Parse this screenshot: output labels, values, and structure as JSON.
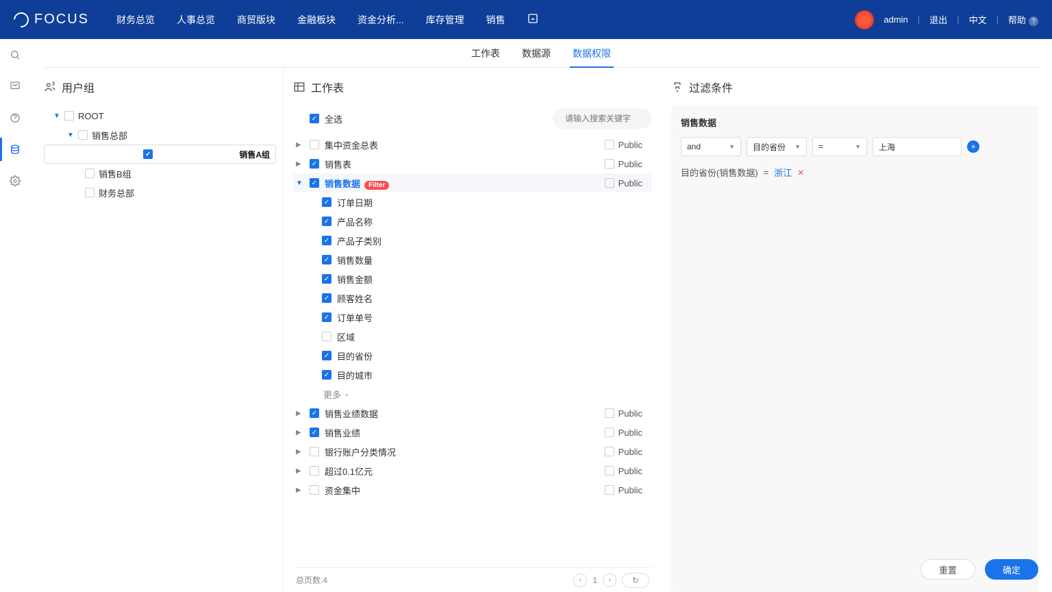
{
  "brand": "FOCUS",
  "topnav": [
    "财务总览",
    "人事总览",
    "商贸版块",
    "金融板块",
    "资金分析...",
    "库存管理",
    "销售"
  ],
  "user": {
    "name": "admin",
    "logout": "退出",
    "lang": "中文",
    "help": "帮助"
  },
  "subnav": {
    "items": [
      "工作表",
      "数据源",
      "数据权限"
    ],
    "active": 2
  },
  "usergroup": {
    "title": "用户组",
    "tree": [
      {
        "label": "ROOT",
        "level": 1,
        "checked": false,
        "caret": "open"
      },
      {
        "label": "销售总部",
        "level": 2,
        "checked": false,
        "caret": "open"
      },
      {
        "label": "销售A组",
        "level": 3,
        "checked": true,
        "selected": true
      },
      {
        "label": "销售B组",
        "level": 3,
        "checked": false
      },
      {
        "label": "财务总部",
        "level": 3,
        "checked": false
      }
    ]
  },
  "worksheet": {
    "title": "工作表",
    "select_all": "全选",
    "search_placeholder": "请输入搜索关键字",
    "rows": [
      {
        "label": "集中资金总表",
        "checked": false,
        "caret": "closed",
        "public": "Public"
      },
      {
        "label": "销售表",
        "checked": true,
        "caret": "closed",
        "public": "Public"
      },
      {
        "label": "销售数据",
        "checked": true,
        "caret": "open",
        "public": "Public",
        "filter": true,
        "active": true
      },
      {
        "label": "订单日期",
        "checked": true,
        "child": true
      },
      {
        "label": "产品名称",
        "checked": true,
        "child": true
      },
      {
        "label": "产品子类别",
        "checked": true,
        "child": true
      },
      {
        "label": "销售数量",
        "checked": true,
        "child": true
      },
      {
        "label": "销售金额",
        "checked": true,
        "child": true
      },
      {
        "label": "顾客姓名",
        "checked": true,
        "child": true
      },
      {
        "label": "订单单号",
        "checked": true,
        "child": true
      },
      {
        "label": "区域",
        "checked": false,
        "child": true
      },
      {
        "label": "目的省份",
        "checked": true,
        "child": true
      },
      {
        "label": "目的城市",
        "checked": true,
        "child": true
      },
      {
        "label": "销售业绩数据",
        "checked": true,
        "caret": "closed",
        "public": "Public"
      },
      {
        "label": "销售业绩",
        "checked": true,
        "caret": "closed",
        "public": "Public"
      },
      {
        "label": "银行账户分类情况",
        "checked": false,
        "caret": "closed",
        "public": "Public"
      },
      {
        "label": "超过0.1亿元",
        "checked": false,
        "caret": "closed",
        "public": "Public"
      },
      {
        "label": "资金集中",
        "checked": false,
        "caret": "closed",
        "public": "Public"
      }
    ],
    "more": "更多",
    "footer_total": "总页数:4",
    "page": "1"
  },
  "filter": {
    "title": "过滤条件",
    "source": "销售数据",
    "builder": {
      "logic": "and",
      "field": "目的省份",
      "op": "=",
      "value": "上海"
    },
    "conditions": [
      {
        "text": "目的省份(销售数据)",
        "op": "=",
        "value": "浙江"
      }
    ]
  },
  "filter_badge": "Filter",
  "public_label": "Public",
  "actions": {
    "reset": "重置",
    "confirm": "确定"
  }
}
